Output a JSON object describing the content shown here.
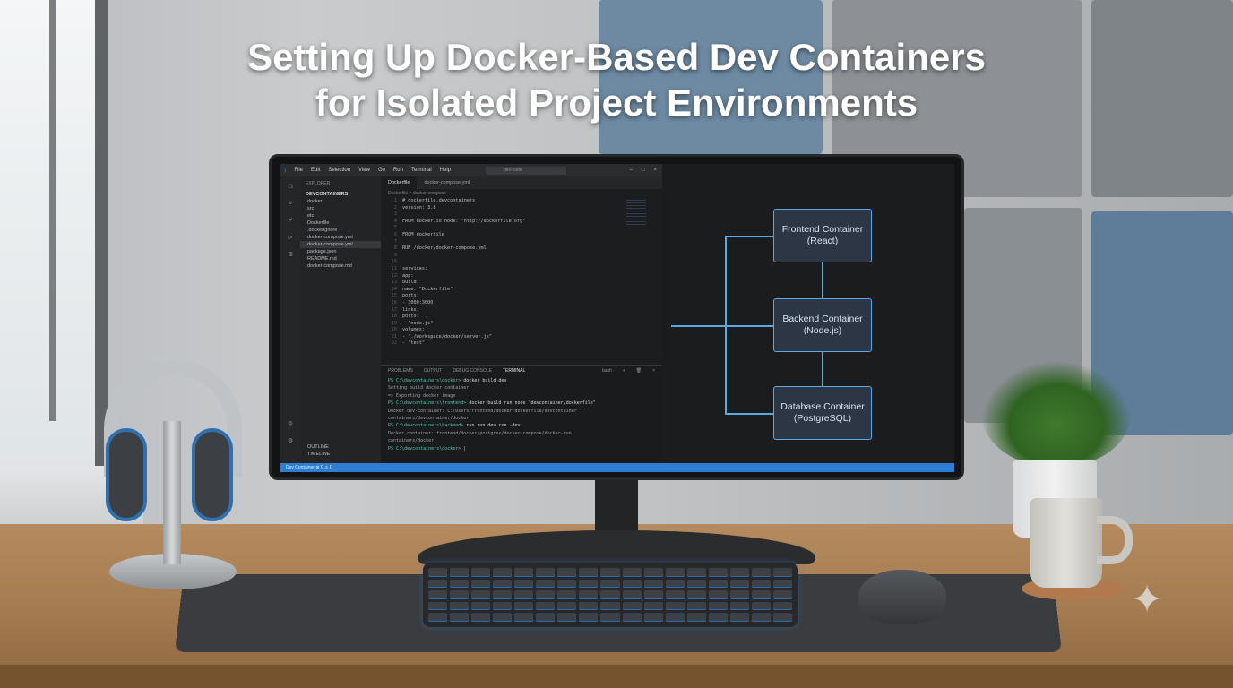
{
  "title": {
    "line1": "Setting Up Docker-Based Dev Containers",
    "line2": "for Isolated Project Environments"
  },
  "vscode": {
    "menu": [
      "File",
      "Edit",
      "Selection",
      "View",
      "Go",
      "Run",
      "Terminal",
      "Help"
    ],
    "search_placeholder": "dev-code",
    "explorer_header": "EXPLORER",
    "section": "DEVCONTAINERS",
    "tree": [
      "docker",
      "src",
      "etc",
      "Dockerfile",
      ".dockerignore",
      "docker-compose.yml",
      "docker-compose.yml",
      "package.json",
      "README.md",
      "docker-compose.md"
    ],
    "sidebar_bottom": [
      "OUTLINE",
      "TIMELINE"
    ],
    "tabs": [
      "Dockerfile",
      "docker-compose.yml"
    ],
    "breadcrumb": "Dockerfile > docker-compose",
    "code_lines": [
      {
        "n": "1",
        "t": "# dockerfile.devcontainers"
      },
      {
        "n": "2",
        "t": "version: 3.8"
      },
      {
        "n": "3",
        "t": ""
      },
      {
        "n": "4",
        "t": "FROM docker.io node: \"http://dockerfile.org\""
      },
      {
        "n": "5",
        "t": ""
      },
      {
        "n": "6",
        "t": "FROM dockerfile"
      },
      {
        "n": "7",
        "t": ""
      },
      {
        "n": "8",
        "t": "RUN /docker/docker-compose.yml"
      },
      {
        "n": "9",
        "t": ""
      },
      {
        "n": "10",
        "t": ""
      },
      {
        "n": "11",
        "t": "services:"
      },
      {
        "n": "12",
        "t": "  app:"
      },
      {
        "n": "13",
        "t": "    build:"
      },
      {
        "n": "14",
        "t": "      name: \"Dockerfile\""
      },
      {
        "n": "15",
        "t": "      ports:"
      },
      {
        "n": "16",
        "t": "        - 3000:3000"
      },
      {
        "n": "17",
        "t": "    links:"
      },
      {
        "n": "18",
        "t": "      ports:"
      },
      {
        "n": "19",
        "t": "        - \"node.js\""
      },
      {
        "n": "20",
        "t": "      volumes:"
      },
      {
        "n": "21",
        "t": "        - \"./workspace/docker/server.js\""
      },
      {
        "n": "22",
        "t": "        - \"test\""
      }
    ],
    "panel_tabs": [
      "PROBLEMS",
      "OUTPUT",
      "DEBUG CONSOLE",
      "TERMINAL"
    ],
    "active_panel_tab": "TERMINAL",
    "terminal_label": "bash",
    "terminal_lines": [
      {
        "prompt": "PS C:\\devcontainers\\docker>",
        "cmd": " docker build dev"
      },
      {
        "prompt": "",
        "cmd": "Setting build docker container"
      },
      {
        "prompt": "",
        "cmd": "=> Exporting docker image"
      },
      {
        "prompt": "PS C:\\devcontainers\\frontend>",
        "cmd": " docker build run node \"devcontainer/dockerfile\""
      },
      {
        "prompt": "",
        "cmd": "Docker dev-container: C:/Users/frontend/docker/dockerfile/devcontainer"
      },
      {
        "prompt": "",
        "cmd": "containers/devcontainer/docker"
      },
      {
        "prompt": "PS C:\\devcontainers\\backend>",
        "cmd": " run run dev run -dev"
      },
      {
        "prompt": "",
        "cmd": "Docker container: frontend/docker/postgres/docker-compose/docker-run"
      },
      {
        "prompt": "",
        "cmd": "containers/docker"
      },
      {
        "prompt": "PS C:\\devcontainers\\docker>",
        "cmd": " |"
      }
    ],
    "status": "Dev Container  ⊗ 0  ⚠ 0"
  },
  "diagram": {
    "boxes": [
      {
        "name": "Frontend Container",
        "detail": "(React)"
      },
      {
        "name": "Backend Container",
        "detail": "(Node.js)"
      },
      {
        "name": "Database Container",
        "detail": "(PostgreSQL)"
      }
    ],
    "line_color": "#5aa9e6",
    "box_fill": "#2c3644"
  },
  "colors": {
    "title_text": "#ffffff",
    "status_bar": "#2d7dd2",
    "keyboard_glow": "#2a6bb0"
  },
  "icons": {
    "sparkle": "sparkle-icon"
  }
}
